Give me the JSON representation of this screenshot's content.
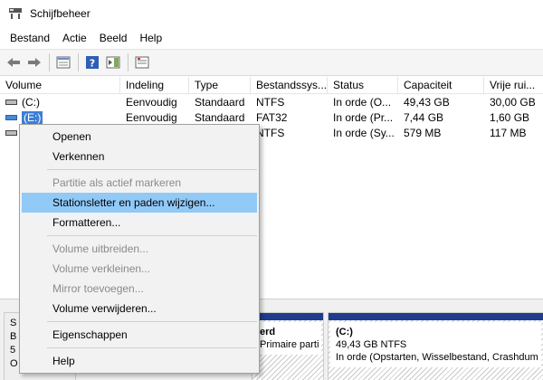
{
  "window": {
    "title": "Schijfbeheer"
  },
  "menu": [
    "Bestand",
    "Actie",
    "Beeld",
    "Help"
  ],
  "table": {
    "headers": [
      "Volume",
      "Indeling",
      "Type",
      "Bestandssys...",
      "Status",
      "Capaciteit",
      "Vrije rui..."
    ],
    "rows": [
      {
        "volume": "(C:)",
        "indeling": "Eenvoudig",
        "type": "Standaard",
        "fs": "NTFS",
        "status": "In orde (O...",
        "capaciteit": "49,43 GB",
        "vrij": "30,00 GB"
      },
      {
        "volume": "(E:)",
        "indeling": "Eenvoudig",
        "type": "Standaard",
        "fs": "FAT32",
        "status": "In orde (Pr...",
        "capaciteit": "7,44 GB",
        "vrij": "1,60 GB"
      },
      {
        "volume": "",
        "indeling": "",
        "type": "",
        "fs": "NTFS",
        "status": "In orde (Sy...",
        "capaciteit": "579 MB",
        "vrij": "117 MB"
      }
    ]
  },
  "bottom": {
    "disk_label_lines": [
      "S",
      "B",
      "5",
      "O"
    ],
    "partition_mid": {
      "line1": "erd",
      "line2": "Primaire parti"
    },
    "partition_c": {
      "line1": "(C:)",
      "line2": "49,43 GB NTFS",
      "line3": "In orde (Opstarten, Wisselbestand, Crashdum"
    }
  },
  "context_menu": {
    "items": [
      {
        "label": "Openen",
        "enabled": true
      },
      {
        "label": "Verkennen",
        "enabled": true
      },
      {
        "label": "Partitie als actief markeren",
        "enabled": false
      },
      {
        "label": "Stationsletter en paden wijzigen...",
        "enabled": true
      },
      {
        "label": "Formatteren...",
        "enabled": true
      },
      {
        "label": "Volume uitbreiden...",
        "enabled": false
      },
      {
        "label": "Volume verkleinen...",
        "enabled": false
      },
      {
        "label": "Mirror toevoegen...",
        "enabled": false
      },
      {
        "label": "Volume verwijderen...",
        "enabled": true
      },
      {
        "label": "Eigenschappen",
        "enabled": true
      },
      {
        "label": "Help",
        "enabled": true
      }
    ]
  }
}
